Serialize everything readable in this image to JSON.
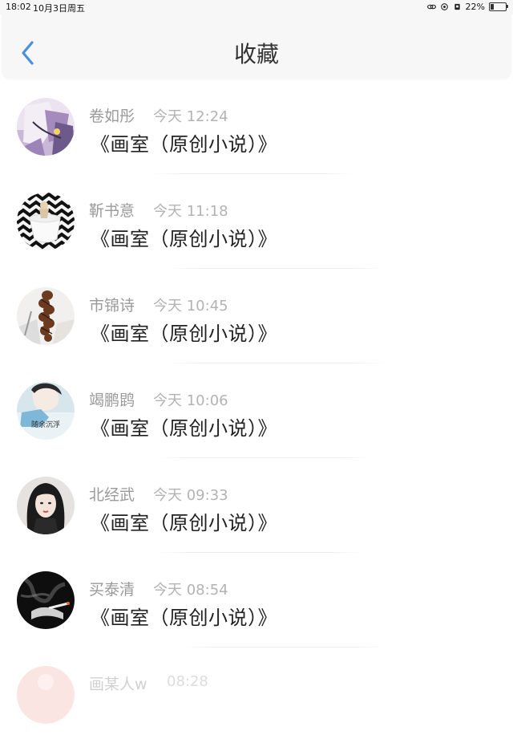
{
  "status_bar": {
    "time": "18:02",
    "date": "10月3日周五",
    "battery": "22%",
    "battery_level": 0.22,
    "icons": [
      "link-icon",
      "at-icon",
      "lock-rotation-icon",
      "battery-icon"
    ]
  },
  "nav": {
    "back_icon": "chevron-left-icon",
    "title": "收藏",
    "accent_color": "#4a90d9"
  },
  "items": [
    {
      "author": "卷如彤",
      "time": "今天 12:24",
      "book": "《画室（原创小说）》",
      "avatar": "illustrated-avatar"
    },
    {
      "author": "靳书意",
      "time": "今天 11:18",
      "book": "《画室（原创小说）》",
      "avatar": "cup-zigzag-avatar"
    },
    {
      "author": "市锦诗",
      "time": "今天 10:45",
      "book": "《画室（原创小说）》",
      "avatar": "braid-avatar"
    },
    {
      "author": "竭鹏鹍",
      "time": "今天 10:06",
      "book": "《画室（原创小说）》",
      "avatar": "calligraphy-avatar"
    },
    {
      "author": "北经武",
      "time": "今天 09:33",
      "book": "《画室（原创小说）》",
      "avatar": "portrait-avatar"
    },
    {
      "author": "买泰清",
      "time": "今天 08:54",
      "book": "《画室（原创小说）》",
      "avatar": "smoke-avatar"
    },
    {
      "author": "画某人w",
      "time": "08:28",
      "book": "",
      "avatar": "pink-avatar"
    }
  ],
  "avatar_texts": {
    "calligraphy": "随余沉浮"
  }
}
